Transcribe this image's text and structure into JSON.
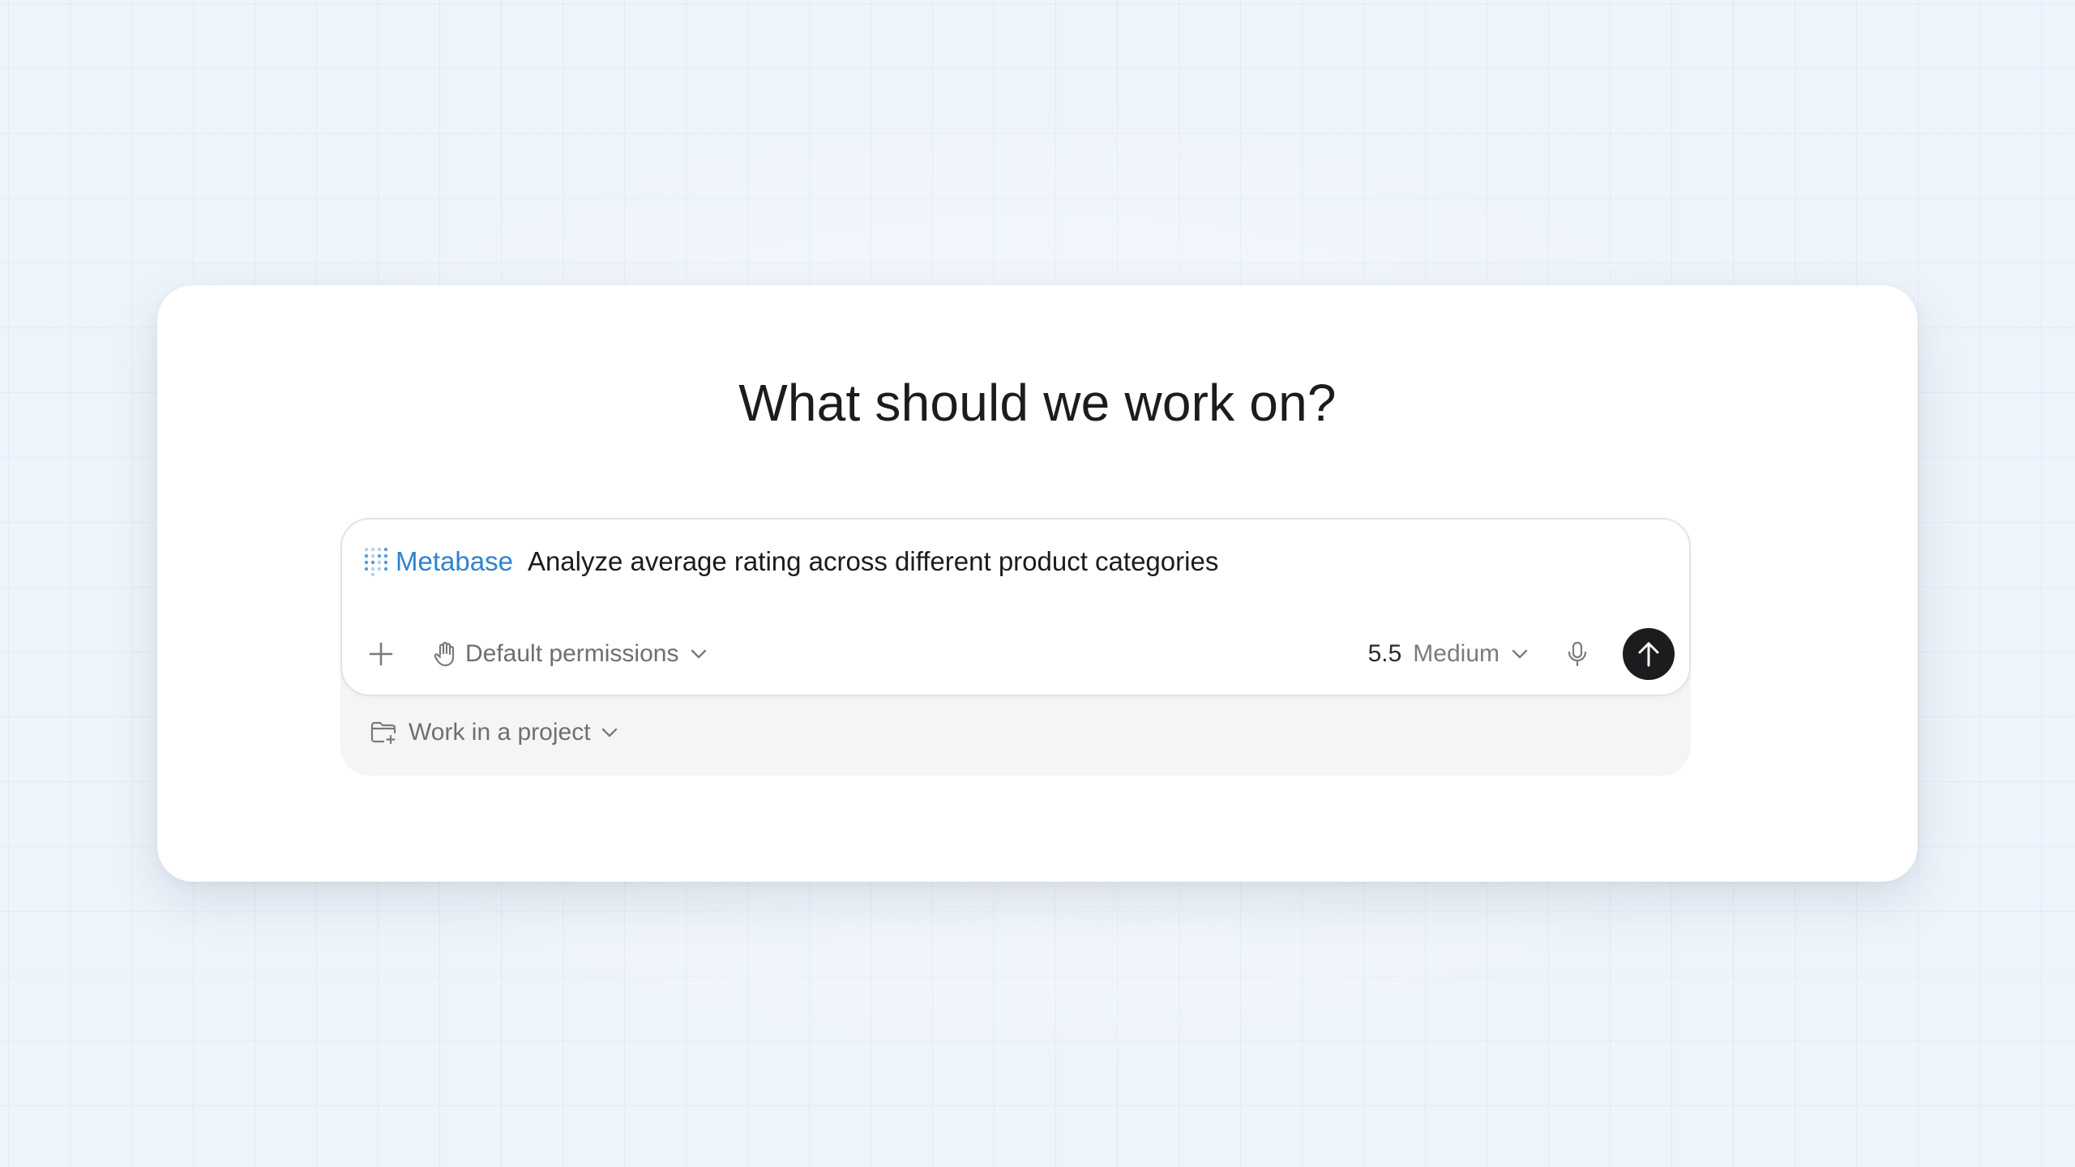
{
  "heading": "What should we work on?",
  "composer": {
    "connector_chip": {
      "label": "Metabase",
      "icon": "metabase-logo",
      "color": "#2e82d0"
    },
    "prompt_text": "Analyze average rating across different product categories",
    "toolbar": {
      "add_icon": "plus-icon",
      "permissions": {
        "icon": "hand-icon",
        "label": "Default permissions"
      },
      "model": {
        "version": "5.5",
        "effort": "Medium"
      },
      "mic_icon": "microphone-icon",
      "send_icon": "arrow-up-icon",
      "send_color": "#1c1c1e"
    }
  },
  "project": {
    "icon": "folder-plus-icon",
    "label": "Work in a project"
  }
}
